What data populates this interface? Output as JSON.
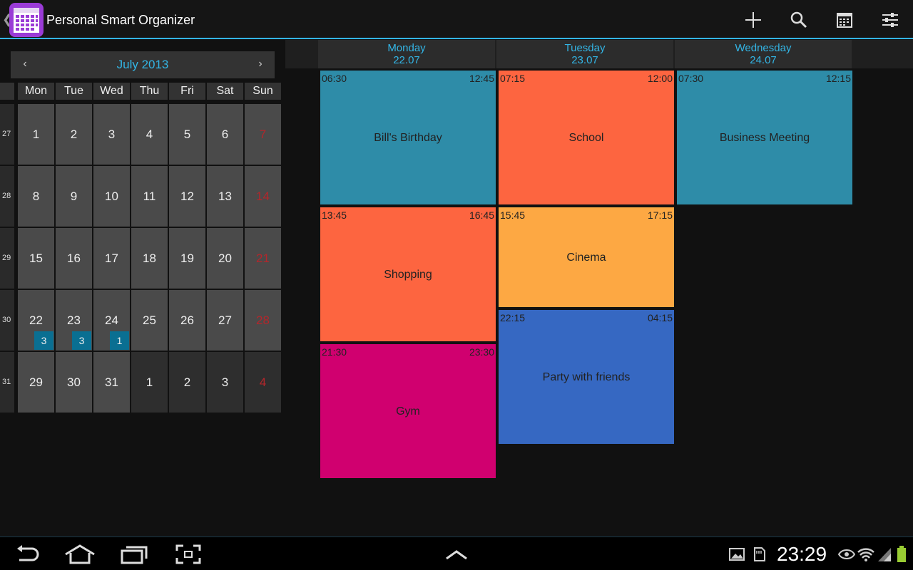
{
  "app": {
    "title": "Personal Smart Organizer",
    "icon": "calendar-app-icon",
    "accent": "#33b5e5"
  },
  "actionbar": {
    "icons": [
      "add-icon",
      "search-icon",
      "calendar-view-icon",
      "settings-sliders-icon"
    ]
  },
  "month_calendar": {
    "title": "July 2013",
    "prev": "‹",
    "next": "›",
    "weekdays": [
      "Mon",
      "Tue",
      "Wed",
      "Thu",
      "Fri",
      "Sat",
      "Sun"
    ],
    "weeks": [
      {
        "num": "27",
        "days": [
          "1",
          "2",
          "3",
          "4",
          "5",
          "6",
          "7"
        ]
      },
      {
        "num": "28",
        "days": [
          "8",
          "9",
          "10",
          "11",
          "12",
          "13",
          "14"
        ]
      },
      {
        "num": "29",
        "days": [
          "15",
          "16",
          "17",
          "18",
          "19",
          "20",
          "21"
        ]
      },
      {
        "num": "30",
        "days": [
          "22",
          "23",
          "24",
          "25",
          "26",
          "27",
          "28"
        ]
      },
      {
        "num": "31",
        "days": [
          "29",
          "30",
          "31",
          "1",
          "2",
          "3",
          "4"
        ]
      }
    ],
    "badges": [
      {
        "week": 3,
        "day": 0,
        "count": "3"
      },
      {
        "week": 3,
        "day": 1,
        "count": "3"
      },
      {
        "week": 3,
        "day": 2,
        "count": "1"
      }
    ],
    "sunday_color": "#b3262b",
    "badge_color": "#0a6f92"
  },
  "week_view": {
    "days": [
      {
        "name": "Monday",
        "date": "22.07"
      },
      {
        "name": "Tuesday",
        "date": "23.07"
      },
      {
        "name": "Wednesday",
        "date": "24.07"
      }
    ],
    "events": [
      {
        "day": 0,
        "start": "06:30",
        "end": "12:45",
        "title": "Bill's Birthday",
        "color": "#2e8ca8"
      },
      {
        "day": 0,
        "start": "13:45",
        "end": "16:45",
        "title": "Shopping",
        "color": "#fd6540"
      },
      {
        "day": 0,
        "start": "21:30",
        "end": "23:30",
        "title": "Gym",
        "color": "#d0006f"
      },
      {
        "day": 1,
        "start": "07:15",
        "end": "12:00",
        "title": "School",
        "color": "#fd6540"
      },
      {
        "day": 1,
        "start": "15:45",
        "end": "17:15",
        "title": "Cinema",
        "color": "#fda843"
      },
      {
        "day": 1,
        "start": "22:15",
        "end": "04:15",
        "title": "Party with friends",
        "color": "#3668c2"
      },
      {
        "day": 2,
        "start": "07:30",
        "end": "12:15",
        "title": "Business Meeting",
        "color": "#2e8ca8"
      }
    ]
  },
  "systembar": {
    "clock": "23:29",
    "nav_icons": [
      "back-icon",
      "home-icon",
      "recent-apps-icon",
      "screenshot-icon",
      "up-chevron-icon"
    ],
    "status_icons": [
      "gallery-icon",
      "sd-card-icon",
      "eye-icon",
      "wifi-icon",
      "signal-icon",
      "battery-icon"
    ]
  }
}
